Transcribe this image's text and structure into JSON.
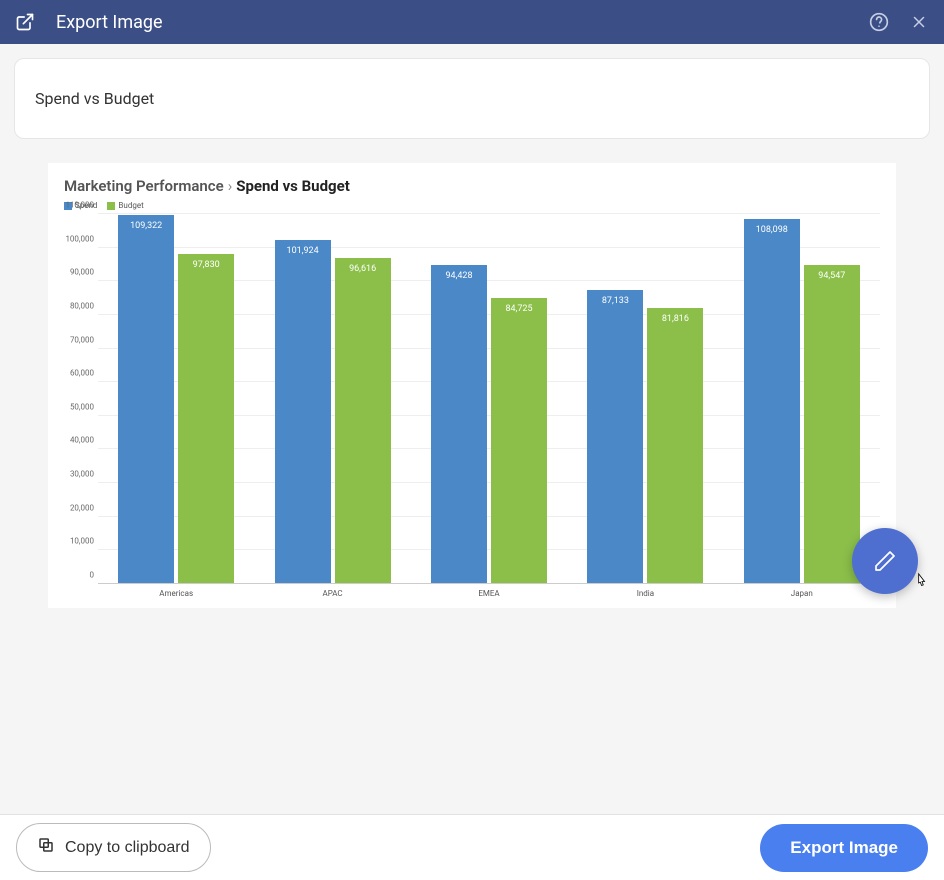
{
  "header": {
    "title": "Export Image"
  },
  "input": {
    "chart_name": "Spend vs Budget"
  },
  "breadcrumb": {
    "parent": "Marketing Performance",
    "current": "Spend vs Budget"
  },
  "legend": {
    "series1": "Spend",
    "series2": "Budget"
  },
  "colors": {
    "spend": "#4a88c7",
    "budget": "#8bbf4a"
  },
  "chart_data": {
    "type": "bar",
    "title": "Spend vs Budget",
    "xlabel": "",
    "ylabel": "",
    "ylim": [
      0,
      110000
    ],
    "y_ticks": [
      0,
      10000,
      20000,
      30000,
      40000,
      50000,
      60000,
      70000,
      80000,
      90000,
      100000,
      110000
    ],
    "y_tick_labels": [
      "0",
      "10,000",
      "20,000",
      "30,000",
      "40,000",
      "50,000",
      "60,000",
      "70,000",
      "80,000",
      "90,000",
      "100,000",
      "110,000"
    ],
    "categories": [
      "Americas",
      "APAC",
      "EMEA",
      "India",
      "Japan"
    ],
    "series": [
      {
        "name": "Spend",
        "values": [
          109322,
          101924,
          94428,
          87133,
          108098
        ],
        "labels": [
          "109,322",
          "101,924",
          "94,428",
          "87,133",
          "108,098"
        ]
      },
      {
        "name": "Budget",
        "values": [
          97830,
          96616,
          84725,
          81816,
          94547
        ],
        "labels": [
          "97,830",
          "96,616",
          "84,725",
          "81,816",
          "94,547"
        ]
      }
    ]
  },
  "footer": {
    "copy_label": "Copy to clipboard",
    "export_label": "Export Image"
  }
}
